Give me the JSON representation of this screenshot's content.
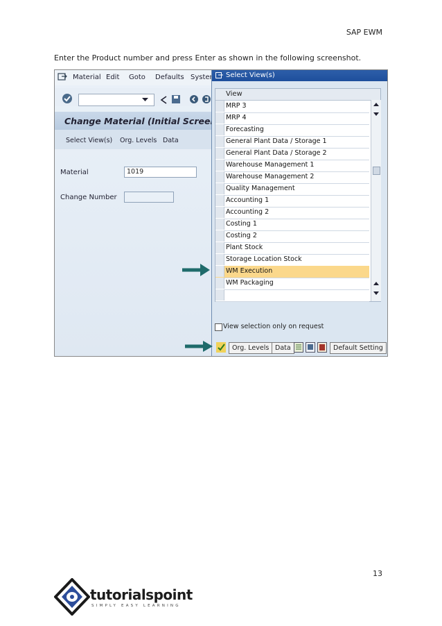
{
  "header": {
    "right_label": "SAP EWM"
  },
  "intro_text": "Enter the Product number and press Enter as shown in the following screenshot.",
  "sap": {
    "menu": [
      "Material",
      "Edit",
      "Goto",
      "Defaults",
      "System"
    ],
    "title": "Change Material (Initial Screen",
    "app_toolbar": [
      "Select View(s)",
      "Org. Levels",
      "Data"
    ],
    "material_label": "Material",
    "material_value": "1019",
    "change_number_label": "Change Number",
    "change_number_value": ""
  },
  "popup": {
    "title": "Select View(s)",
    "column_header": "View",
    "views": [
      "MRP 3",
      "MRP 4",
      "Forecasting",
      "General Plant Data / Storage 1",
      "General Plant Data / Storage 2",
      "Warehouse Management 1",
      "Warehouse Management 2",
      "Quality Management",
      "Accounting 1",
      "Accounting 2",
      "Costing 1",
      "Costing 2",
      "Plant Stock",
      "Storage Location Stock",
      "WM Execution",
      "WM Packaging"
    ],
    "highlighted_view": "WM Execution",
    "checkbox_label": "View selection only on request",
    "footer_buttons": [
      "Org. Levels",
      "Data",
      "Default Setting"
    ]
  },
  "footer": {
    "page_number": "13",
    "logo_text": "tutorialspoint",
    "logo_tagline": "SIMPLY EASY LEARNING"
  },
  "colors": {
    "highlight": "#fbd88b",
    "arrow": "#1f6b6b",
    "titlebar": "#1e4f9c"
  }
}
